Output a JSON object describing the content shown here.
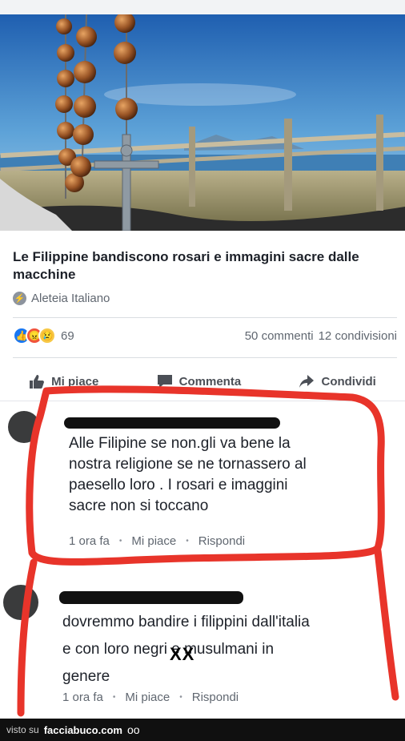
{
  "article": {
    "title": "Le Filippine bandiscono rosari e immagini sacre dalle macchine",
    "source": "Aleteia Italiano"
  },
  "engagement": {
    "reactions": [
      "like",
      "angry",
      "sad"
    ],
    "reaction_count": "69",
    "comments": "50 commenti",
    "shares": "12 condivisioni"
  },
  "actions": {
    "like": "Mi piace",
    "comment": "Commenta",
    "share": "Condividi"
  },
  "comments": [
    {
      "lines": [
        "Alle Filipine se non.gli va bene la",
        "nostra religione se ne tornassero al",
        "paesello loro .  I rosari e imaggini",
        "sacre non si toccano"
      ],
      "time": "1 ora fa",
      "like": "Mi piace",
      "reply": "Rispondi"
    },
    {
      "lines": [
        "dovremmo bandire i filippini dall'italia",
        "e con loro negri e musulmani in",
        "genere"
      ],
      "time": "1 ora fa",
      "like": "Mi piace",
      "reply": "Rispondi",
      "censor_mark": "XX"
    }
  ],
  "footer": {
    "prefix": "visto su",
    "site": "facciabuco.com",
    "logo": "oo"
  },
  "colors": {
    "annotation_red": "#e8342a",
    "link_blue": "#1877f2"
  }
}
